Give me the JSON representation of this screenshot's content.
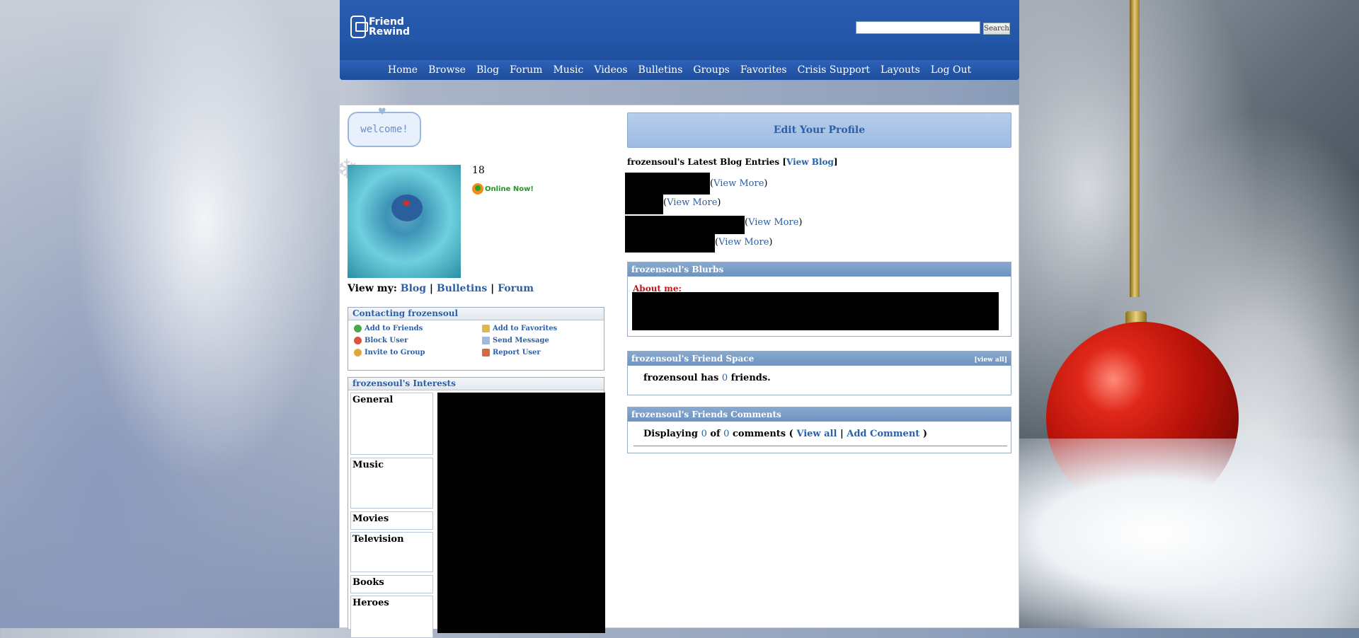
{
  "header": {
    "logo_line1": "Friend",
    "logo_line2": "Rewind",
    "search_placeholder": "",
    "search_button": "Search"
  },
  "nav": [
    "Home",
    "Browse",
    "Blog",
    "Forum",
    "Music",
    "Videos",
    "Bulletins",
    "Groups",
    "Favorites",
    "Crisis Support",
    "Layouts",
    "Log Out"
  ],
  "profile": {
    "welcome_badge": "welcome!",
    "age": "18",
    "online_status": "Online Now!",
    "view_my_label": "View my:",
    "view_my_links": [
      "Blog",
      "Bulletins",
      "Forum"
    ]
  },
  "contacting": {
    "title": "Contacting frozensoul",
    "items": [
      {
        "label": "Add to Friends",
        "icon": "add-friend-icon"
      },
      {
        "label": "Add to Favorites",
        "icon": "favorite-icon"
      },
      {
        "label": "Block User",
        "icon": "block-icon"
      },
      {
        "label": "Send Message",
        "icon": "mail-icon"
      },
      {
        "label": "Invite to Group",
        "icon": "group-icon"
      },
      {
        "label": "Report User",
        "icon": "report-icon"
      }
    ]
  },
  "interests": {
    "title": "frozensoul's Interests",
    "categories": [
      "General",
      "Music",
      "Movies",
      "Television",
      "Books",
      "Heroes"
    ]
  },
  "right": {
    "edit_profile": "Edit Your Profile",
    "blog_heading_prefix": "frozensoul's Latest Blog Entries [",
    "blog_heading_link": "View Blog",
    "blog_heading_suffix": "]",
    "view_more": "View More",
    "blurbs_title": "frozensoul's Blurbs",
    "about_me": "About me:",
    "friend_space_title": "frozensoul's Friend Space",
    "friend_space_view_all": "[view all]",
    "friend_count_prefix": "frozensoul has",
    "friend_count": "0",
    "friend_count_suffix": "friends.",
    "comments_title": "frozensoul's Friends Comments",
    "comments_displaying": "Displaying",
    "comments_shown": "0",
    "comments_of": "of",
    "comments_total": "0",
    "comments_word": "comments (",
    "comments_view_all": "View all",
    "comments_add": "Add Comment",
    "comments_close": ")"
  },
  "colors": {
    "header_blue": "#2457aa",
    "link_blue": "#2b5fa6",
    "box_header_blue": "#7a9dc8",
    "about_red": "#c0161c",
    "online_green": "#1c9a1c"
  }
}
